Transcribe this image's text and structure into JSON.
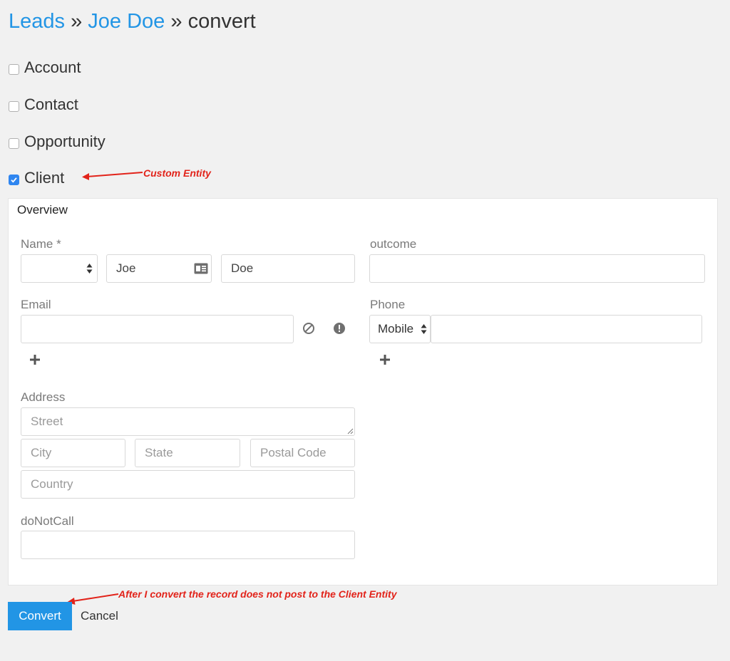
{
  "breadcrumb": {
    "root": "Leads",
    "record": "Joe Doe",
    "current": "convert",
    "separator": "»"
  },
  "entities": [
    {
      "label": "Account",
      "checked": false
    },
    {
      "label": "Contact",
      "checked": false
    },
    {
      "label": "Opportunity",
      "checked": false
    },
    {
      "label": "Client",
      "checked": true
    }
  ],
  "annotations": {
    "custom_entity": "Custom Entity",
    "after_convert": "After I convert the record does not post to the Client Entity"
  },
  "panel": {
    "title": "Overview",
    "name": {
      "label": "Name *",
      "salutation": "",
      "first": "Joe",
      "last": "Doe"
    },
    "outcome": {
      "label": "outcome",
      "value": ""
    },
    "email": {
      "label": "Email",
      "value": ""
    },
    "phone": {
      "label": "Phone",
      "type": "Mobile",
      "value": ""
    },
    "address": {
      "label": "Address",
      "street_ph": "Street",
      "city_ph": "City",
      "state_ph": "State",
      "postal_ph": "Postal Code",
      "country_ph": "Country"
    },
    "donotcall": {
      "label": "doNotCall",
      "value": ""
    }
  },
  "actions": {
    "convert": "Convert",
    "cancel": "Cancel"
  },
  "colors": {
    "link": "#2295e5",
    "primary": "#2295e5",
    "annotation": "#e2231a"
  },
  "icons": [
    "checkbox-check-icon",
    "updown-arrows-icon",
    "contact-card-icon",
    "opt-out-icon",
    "invalid-icon",
    "plus-icon",
    "resize-handle-icon",
    "arrow-icon"
  ]
}
